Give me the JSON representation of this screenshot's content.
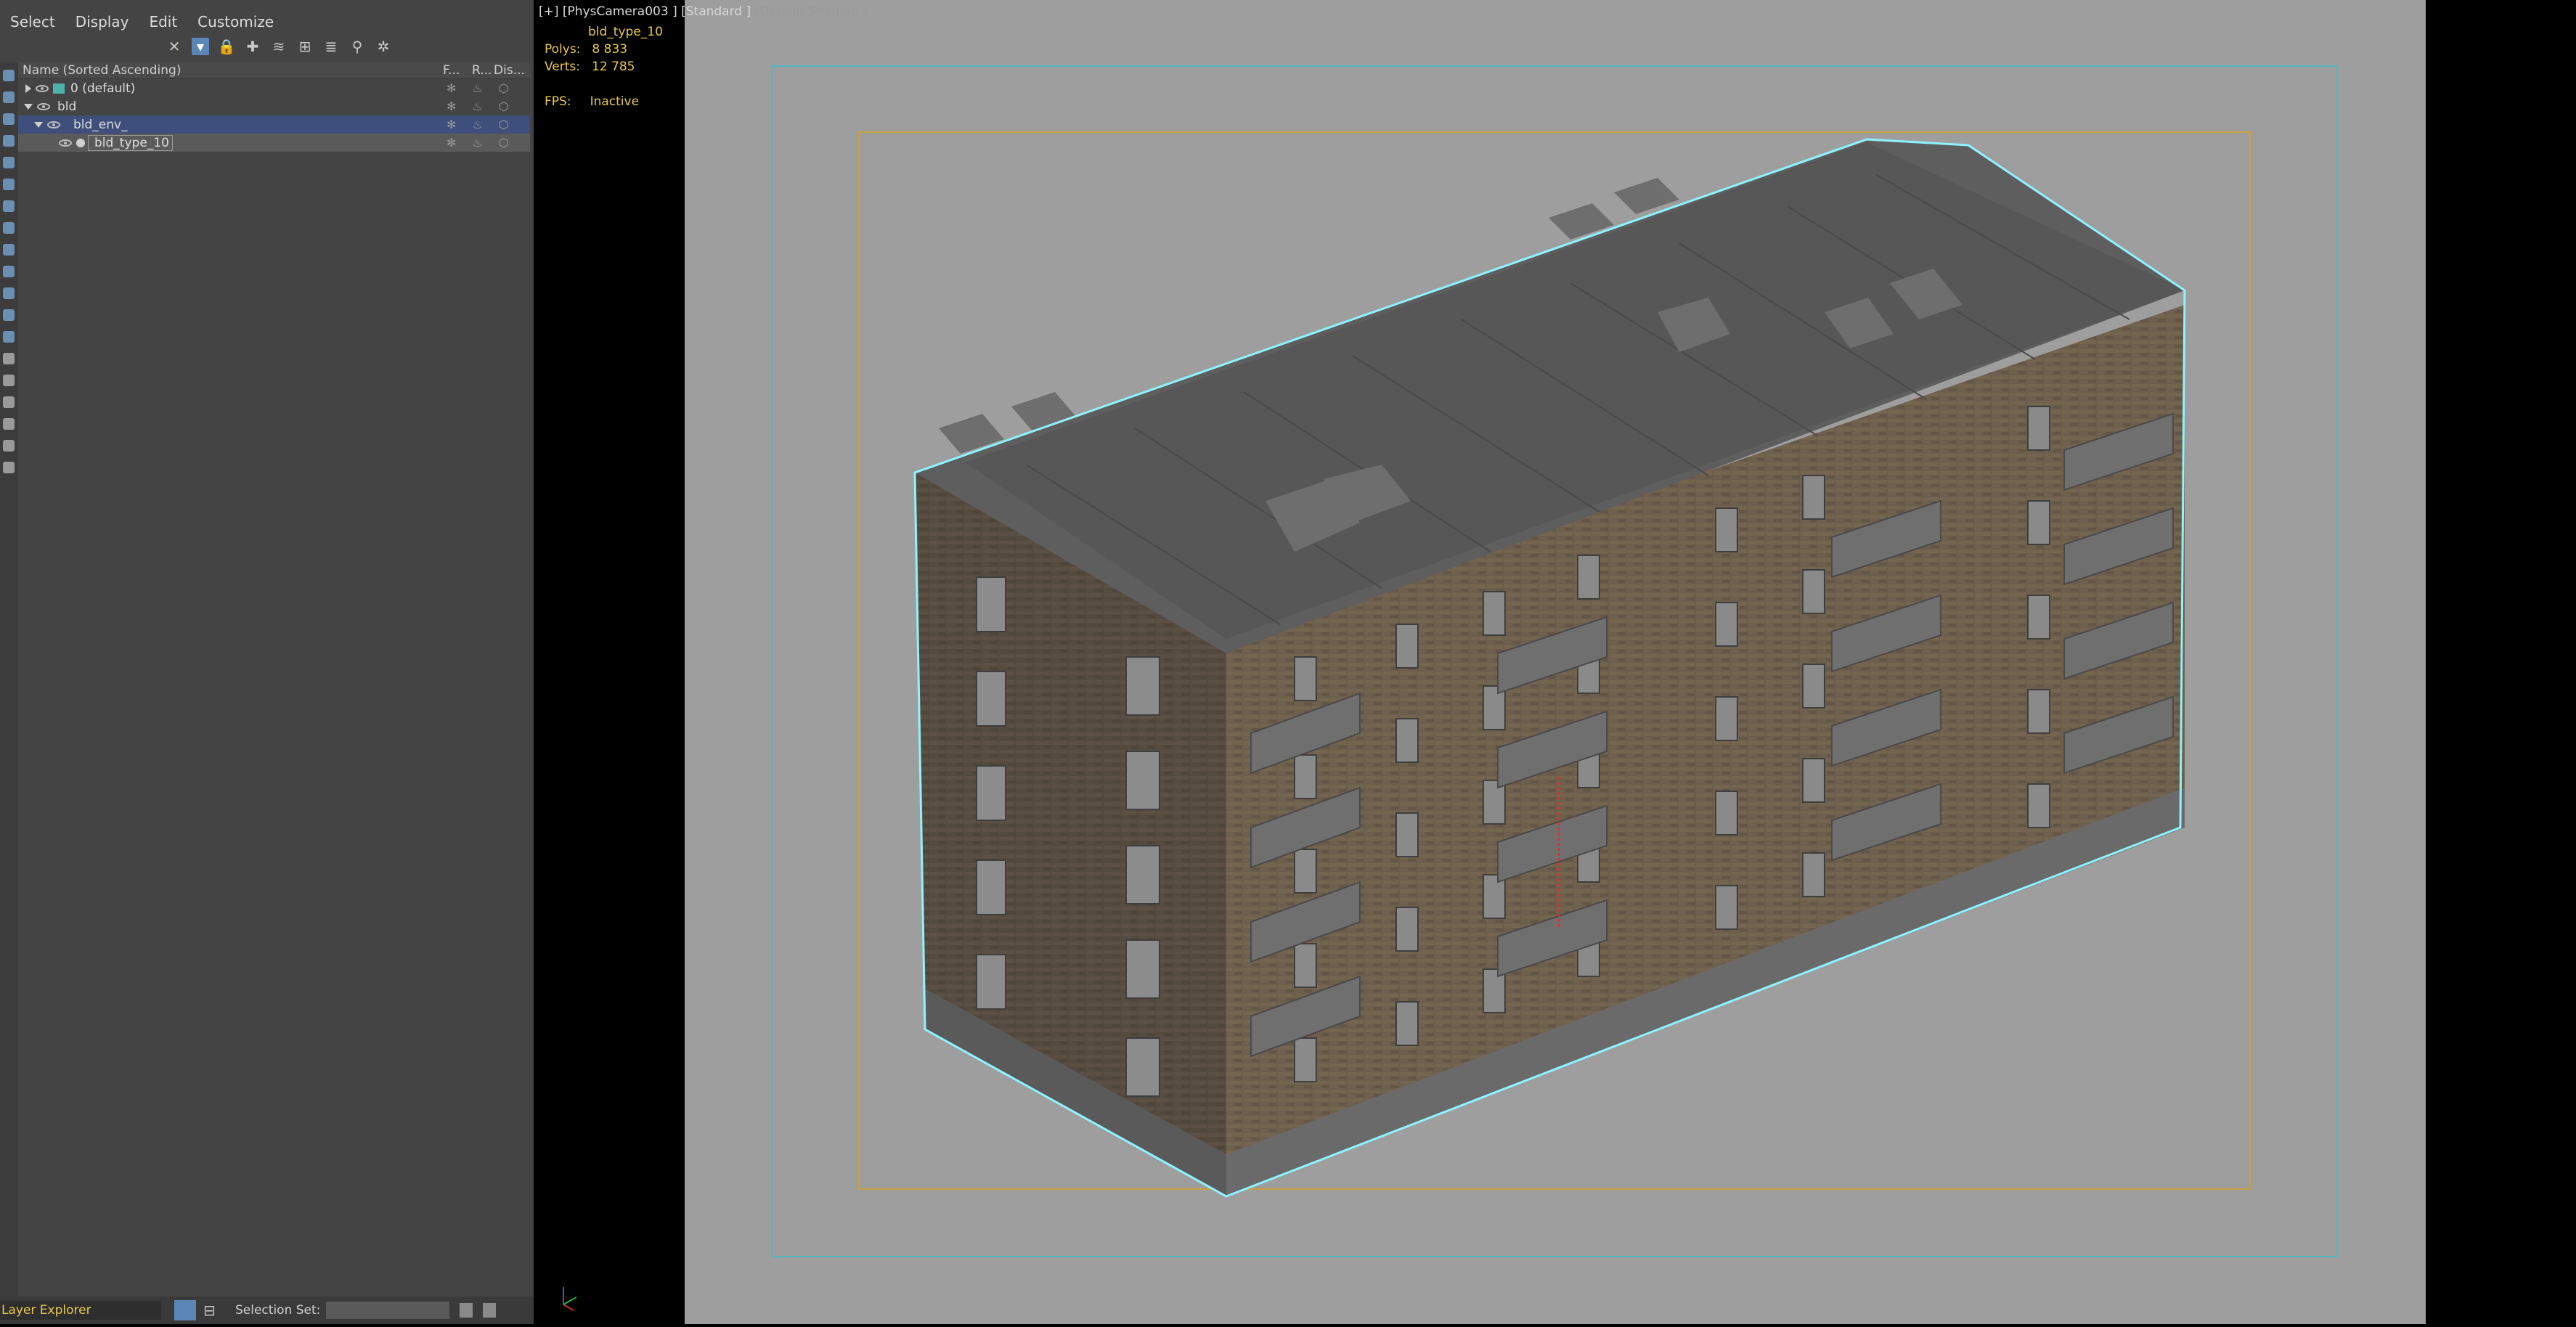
{
  "menu": {
    "select": "Select",
    "display": "Display",
    "edit": "Edit",
    "customize": "Customize"
  },
  "tree": {
    "header": {
      "name": "Name (Sorted Ascending)",
      "col_f": "F...",
      "col_r": "R...",
      "col_d": "Dis..."
    },
    "rows": [
      {
        "label": "0 (default)"
      },
      {
        "label": "bld"
      },
      {
        "label": "bld_env_"
      },
      {
        "label": "bld_type_10"
      }
    ]
  },
  "status": {
    "explorer": "Layer Explorer",
    "selection_set_label": "Selection Set:",
    "selection_set_value": ""
  },
  "viewport": {
    "label_prefix": "[+]",
    "camera": "[PhysCamera003 ]",
    "standard": "[Standard ]",
    "shading": "[Default Shading ]",
    "object_name": "bld_type_10",
    "polys_label": "Polys:",
    "polys_value": "8 833",
    "verts_label": "Verts:",
    "verts_value": "12 785",
    "fps_label": "FPS:",
    "fps_value": "Inactive"
  },
  "colors": {
    "accent": "#5b86b8",
    "hud_yellow": "#e8c84a",
    "selection_cyan": "#8ff3ff",
    "safe_frame": "#c8a040"
  }
}
